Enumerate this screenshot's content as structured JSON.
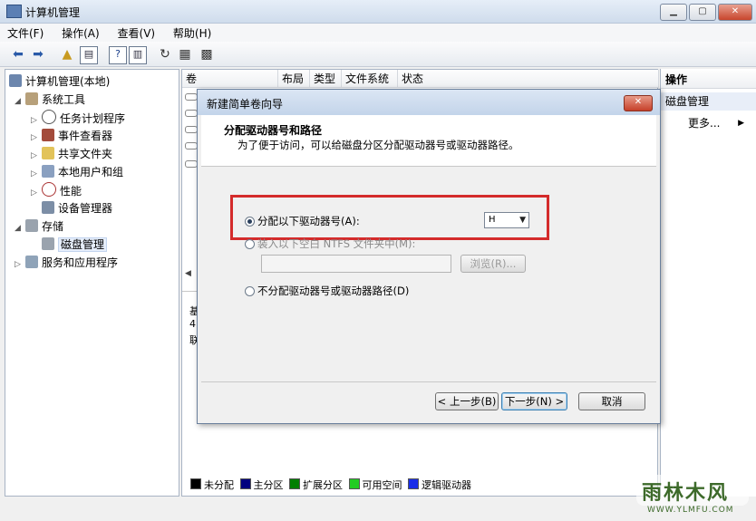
{
  "window": {
    "title": "计算机管理"
  },
  "menu": [
    "文件(F)",
    "操作(A)",
    "查看(V)",
    "帮助(H)"
  ],
  "tree": {
    "root": "计算机管理(本地)",
    "system_tools": "系统工具",
    "task_scheduler": "任务计划程序",
    "event_viewer": "事件查看器",
    "shared_folders": "共享文件夹",
    "local_users": "本地用户和组",
    "performance": "性能",
    "device_manager": "设备管理器",
    "storage": "存储",
    "disk_management": "磁盘管理",
    "services_apps": "服务和应用程序"
  },
  "columns": [
    "卷",
    "布局",
    "类型",
    "文件系统",
    "状态"
  ],
  "lower_left_chars": [
    "基",
    "4",
    "联"
  ],
  "legend": [
    {
      "label": "未分配",
      "color": "#000000"
    },
    {
      "label": "主分区",
      "color": "#00007f"
    },
    {
      "label": "扩展分区",
      "color": "#007f00"
    },
    {
      "label": "可用空间",
      "color": "#22cc22"
    },
    {
      "label": "逻辑驱动器",
      "color": "#1a2ee8"
    }
  ],
  "actions": {
    "header": "操作",
    "section": "磁盘管理",
    "more": "更多..."
  },
  "dialog": {
    "title": "新建简单卷向导",
    "heading": "分配驱动器号和路径",
    "subheading": "为了便于访问，可以给磁盘分区分配驱动器号或驱动器路径。",
    "opt_assign": "分配以下驱动器号(A):",
    "drive_letter": "H",
    "opt_mount": "装入以下空白 NTFS 文件夹中(M):",
    "browse": "浏览(R)...",
    "opt_none": "不分配驱动器号或驱动器路径(D)",
    "back": "< 上一步(B)",
    "next": "下一步(N) >",
    "cancel": "取消"
  },
  "watermark": {
    "brand": "雨林木风",
    "url": "WWW.YLMFU.COM"
  }
}
